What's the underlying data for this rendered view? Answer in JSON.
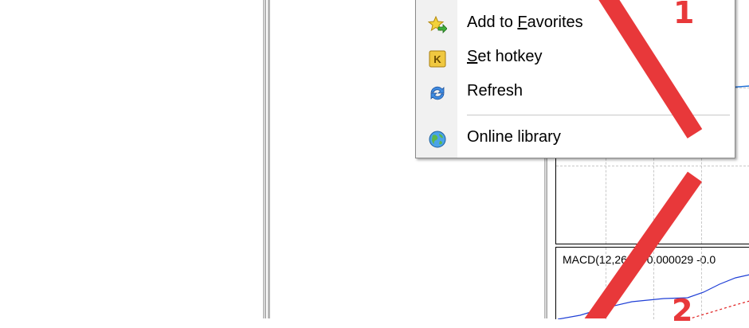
{
  "context_menu": {
    "items": [
      {
        "label": "Add to Favorites",
        "icon": "star-add-icon",
        "accesskey": "F"
      },
      {
        "label": "Set hotkey",
        "icon": "hotkey-k-icon",
        "accesskey": "S"
      },
      {
        "label": "Refresh",
        "icon": "refresh-icon",
        "accesskey": ""
      },
      {
        "label": "Online library",
        "icon": "globe-icon",
        "accesskey": ""
      }
    ]
  },
  "chart": {
    "indicator_label": "MACD(12,26,9) -0.000029 -0.0"
  },
  "annotations": {
    "marker_1": "1",
    "marker_2": "2",
    "color": "#e8383a"
  },
  "colors": {
    "macd_line": "#1f3fd6",
    "signal_line": "#e02020",
    "price_line": "#1f6fd6"
  }
}
